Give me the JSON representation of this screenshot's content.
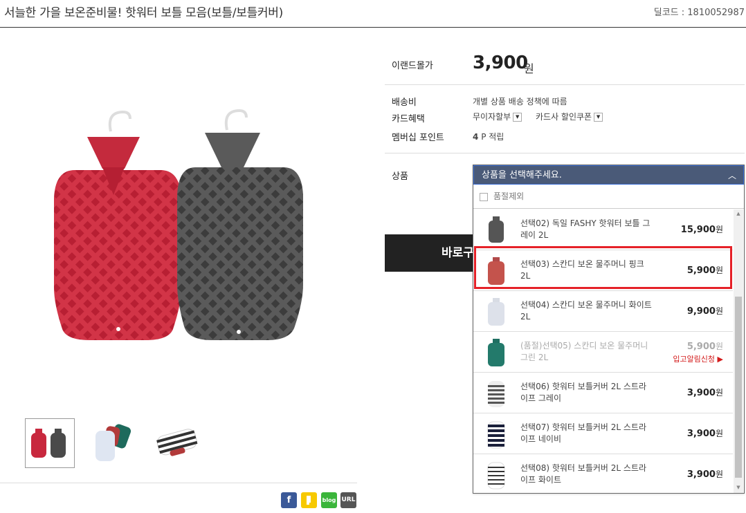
{
  "header": {
    "title": "서늘한 가을 보온준비물! 핫워터 보틀 모음(보틀/보틀커버)",
    "deal_code": "딜코드 : 1810052987"
  },
  "price": {
    "label": "이랜드몰가",
    "amount": "3,900",
    "unit": "원"
  },
  "shipping": {
    "label": "배송비",
    "value": "개별 상품 배송 정책에 따름"
  },
  "card": {
    "label": "카드혜택",
    "installment": "무이자할부",
    "coupon": "카드사 할인쿠폰"
  },
  "membership": {
    "label": "멤버십 포인트",
    "points": "4",
    "suffix": "P 적립"
  },
  "product": {
    "label": "상품"
  },
  "buy_button": "바로구",
  "dropdown": {
    "placeholder": "상품을 선택해주세요.",
    "exclude_soldout": "품절제외",
    "options": [
      {
        "name": "선택02) 독일 FASHY 핫워터 보틀 그레이 2L",
        "price": "15,900",
        "won": "원",
        "thumb": "gray-bottle"
      },
      {
        "name": "선택03) 스칸디 보온 물주머니 핑크 2L",
        "price": "5,900",
        "won": "원",
        "thumb": "pink-bottle"
      },
      {
        "name": "선택04) 스칸디 보온 물주머니 화이트 2L",
        "price": "9,900",
        "won": "원",
        "thumb": "white-bottle"
      },
      {
        "name": "(품절)선택05) 스칸디 보온 물주머니 그린 2L",
        "price": "5,900",
        "won": "원",
        "thumb": "green-bottle",
        "restock": "입고알림신청 ▶"
      },
      {
        "name": "선택06) 핫워터 보틀커버 2L 스트라이프 그레이",
        "price": "3,900",
        "won": "원",
        "thumb": "stripe-gray-cover"
      },
      {
        "name": "선택07) 핫워터 보틀커버 2L 스트라이프 네이비",
        "price": "3,900",
        "won": "원",
        "thumb": "stripe-navy-cover"
      },
      {
        "name": "선택08) 핫워터 보틀커버 2L 스트라이프 화이트",
        "price": "3,900",
        "won": "원",
        "thumb": "stripe-white-cover"
      }
    ]
  },
  "share": {
    "facebook": "f",
    "kakao": "",
    "blog": "blog",
    "url": "URL"
  },
  "colors": {
    "dropdown_header": "#4a5a78",
    "highlight": "#e52128",
    "restock": "#d31b1b",
    "pink": "#c8283e",
    "gray": "#4a4a4a"
  }
}
